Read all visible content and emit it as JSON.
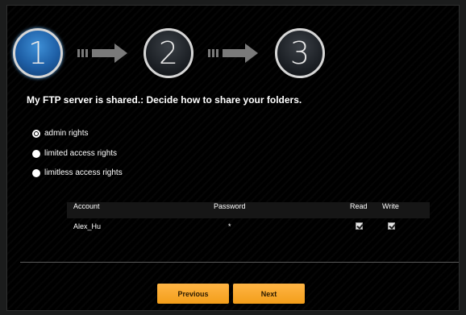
{
  "wizard": {
    "steps": [
      "1",
      "2",
      "3"
    ],
    "active_step": 1
  },
  "heading": "My FTP server is shared.: Decide how to share your folders.",
  "access_options": [
    {
      "label": "admin rights",
      "selected": true
    },
    {
      "label": "limited access rights",
      "selected": false
    },
    {
      "label": "limitless access rights",
      "selected": false
    }
  ],
  "table": {
    "headers": {
      "account": "Account",
      "password": "Password",
      "read": "Read",
      "write": "Write"
    },
    "rows": [
      {
        "account": "Alex_Hu",
        "password": "*",
        "read": true,
        "write": true
      }
    ]
  },
  "buttons": {
    "previous": "Previous",
    "next": "Next"
  },
  "colors": {
    "accent": "#f5a623",
    "active_step": "#1e5fa6"
  }
}
